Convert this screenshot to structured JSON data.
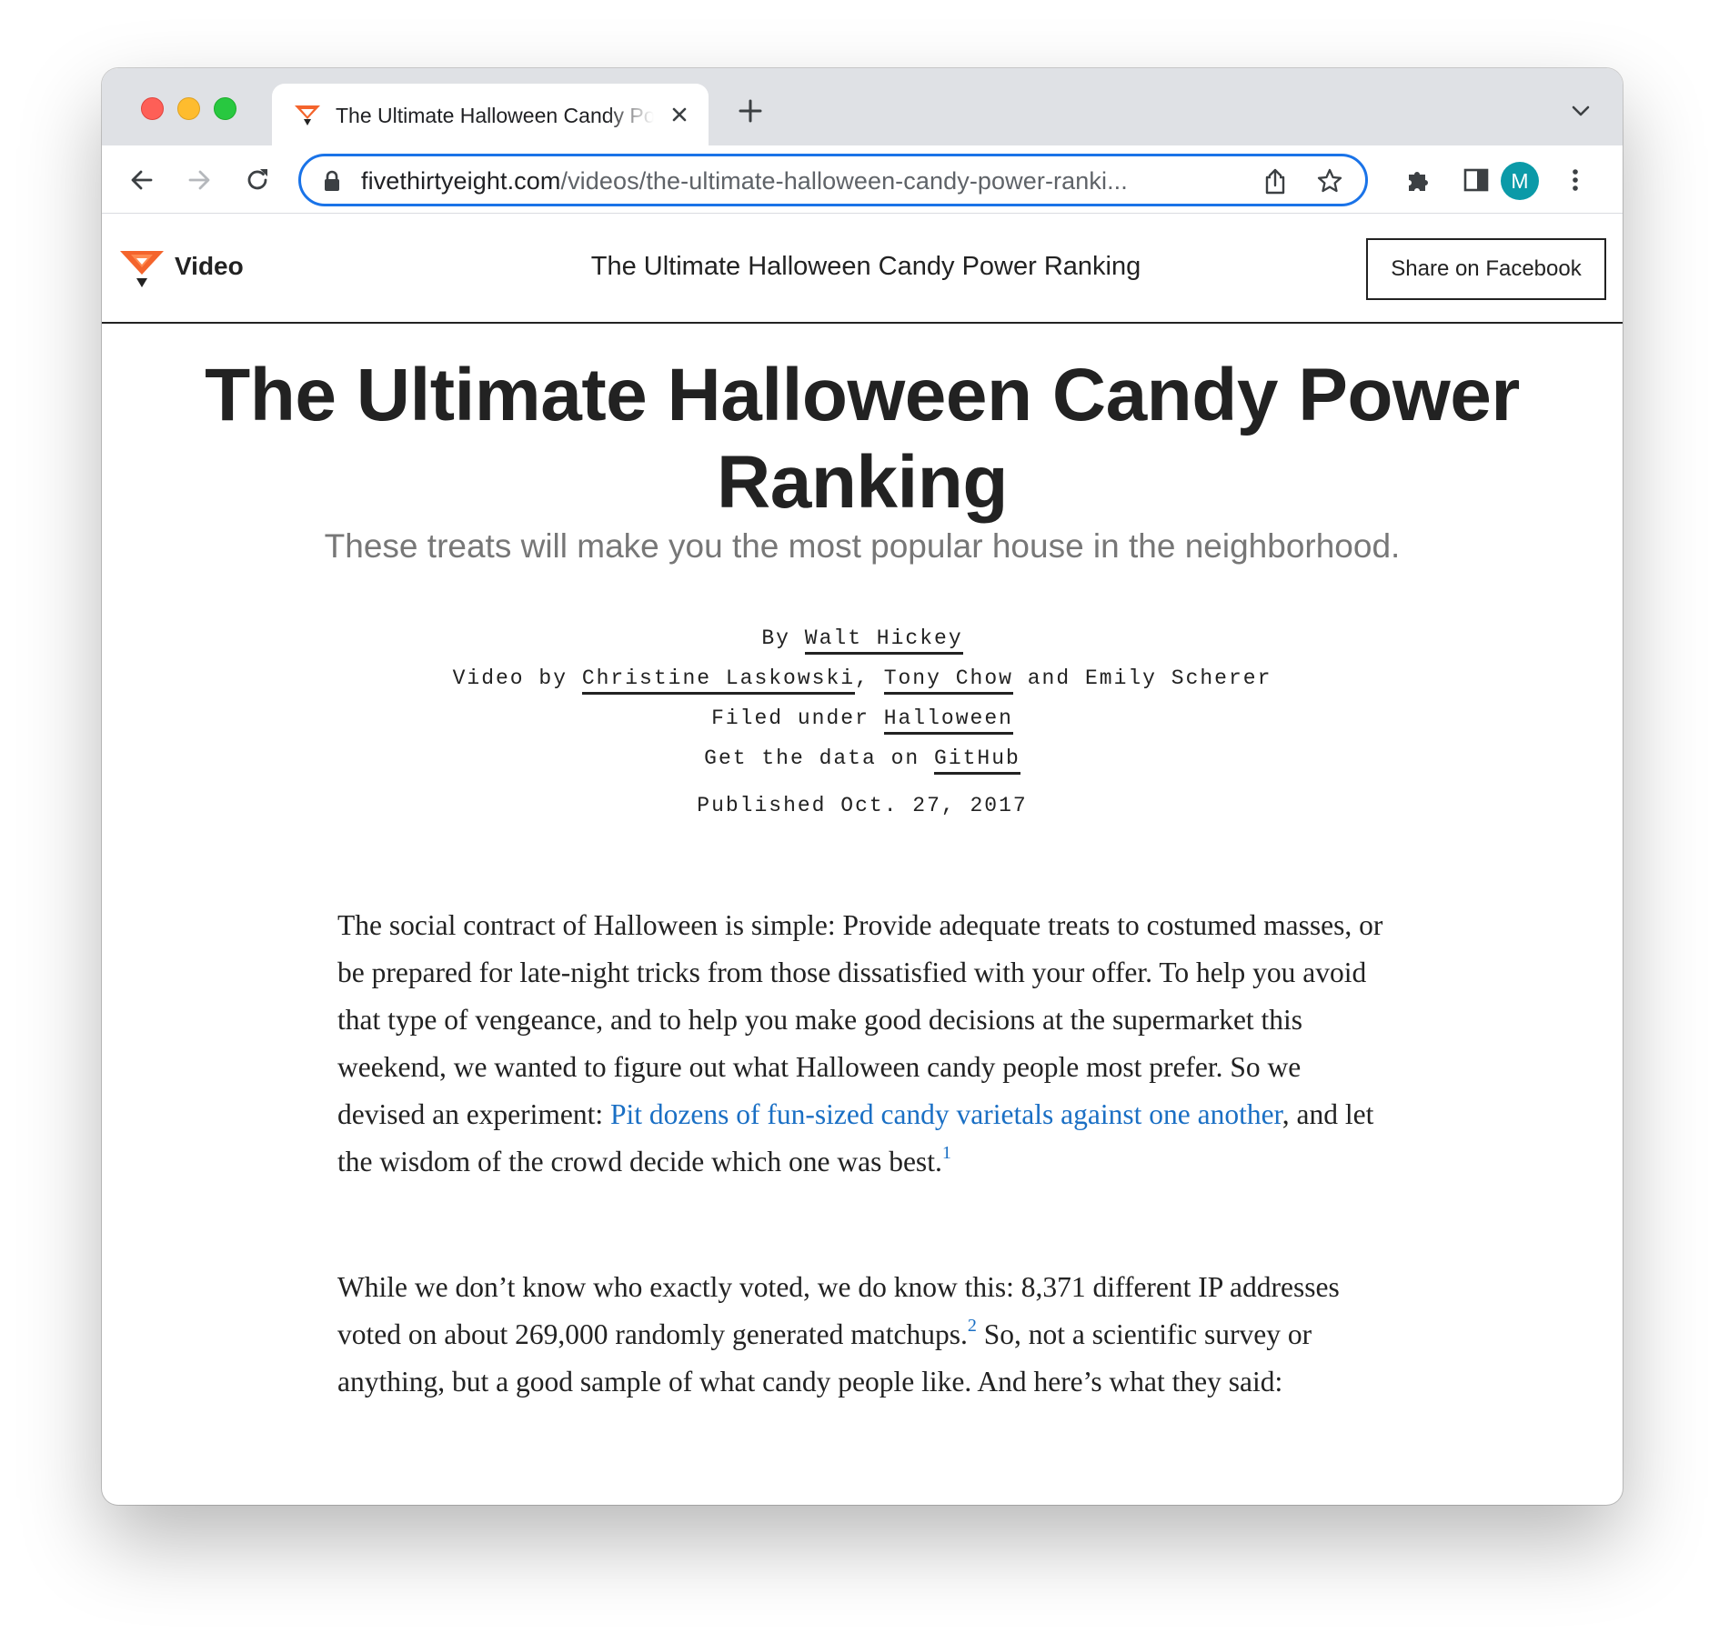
{
  "browser": {
    "tab": {
      "title": "The Ultimate Halloween Candy Power Ranking"
    },
    "address_bar": {
      "host": "fivethirtyeight.com",
      "path": "/videos/the-ultimate-halloween-candy-power-ranki..."
    },
    "profile": {
      "initial": "M",
      "color": "#0b9aa8"
    },
    "accent_color": "#1a73e8"
  },
  "site_header": {
    "section": "Video",
    "title": "The Ultimate Halloween Candy Power Ranking",
    "share_button": "Share on Facebook",
    "logo_color": "#f4642c"
  },
  "article": {
    "headline": "The Ultimate Halloween Candy Power Ranking",
    "dek": "These treats will make you the most popular house in the neighborhood.",
    "byline": {
      "by_prefix": "By",
      "author": "Walt Hickey",
      "video_prefix": "Video by",
      "video_author_1": "Christine Laskowski",
      "video_sep": ",",
      "video_author_2": "Tony Chow",
      "video_and": "and Emily Scherer",
      "filed_prefix": "Filed under",
      "filed_topic": "Halloween",
      "data_prefix": "Get the data on",
      "data_link": "GitHub",
      "published": "Published Oct. 27, 2017"
    },
    "paragraph_1": {
      "text_before_link": "The social contract of Halloween is simple: Provide adequate treats to costumed masses, or be prepared for late-night tricks from those dissatisfied with your offer. To help you avoid that type of vengeance, and to help you make good decisions at the supermarket this weekend, we wanted to figure out what Halloween candy people most prefer. So we devised an experiment: ",
      "link_text": "Pit dozens of fun-sized candy varietals against one another",
      "text_after_link": ", and let the wisdom of the crowd decide which one was best.",
      "footnote": "1"
    },
    "paragraph_2": {
      "text_before_footnote": "While we don’t know who exactly voted, we do know this: 8,371 different IP addresses voted on about 269,000 randomly generated matchups.",
      "footnote": "2",
      "text_after_footnote": " So, not a scientific survey or anything, but a good sample of what candy people like. And here’s what they said:"
    },
    "link_color": "#1a6fc4"
  }
}
